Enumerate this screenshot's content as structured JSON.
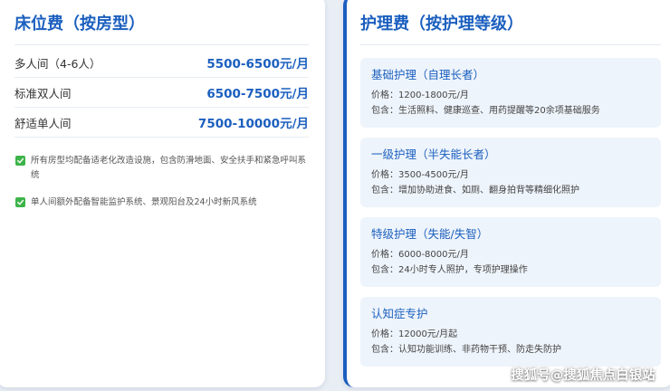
{
  "bed_fee": {
    "title": "床位费（按房型）",
    "rows": [
      {
        "label": "多人间（4-6人）",
        "price": "5500-6500元/月"
      },
      {
        "label": "标准双人间",
        "price": "6500-7500元/月"
      },
      {
        "label": "舒适单人间",
        "price": "7500-10000元/月"
      }
    ],
    "notes": [
      "所有房型均配备适老化改造设施，包含防滑地面、安全扶手和紧急呼叫系统",
      "单人间额外配备智能监护系统、景观阳台及24小时新风系统"
    ]
  },
  "care_fee": {
    "title": "护理费（按护理等级）",
    "items": [
      {
        "name": "基础护理（自理长者）",
        "price": "价格：1200-1800元/月",
        "includes": "包含：生活照料、健康巡查、用药提醒等20余项基础服务"
      },
      {
        "name": "一级护理（半失能长者）",
        "price": "价格：3500-4500元/月",
        "includes": "包含：增加协助进食、如厕、翻身拍背等精细化照护"
      },
      {
        "name": "特级护理（失能/失智）",
        "price": "价格：6000-8000元/月",
        "includes": "包含：24小时专人照护，专项护理操作"
      },
      {
        "name": "认知症专护",
        "price": "价格：12000元/月起",
        "includes": "包含：认知功能训练、非药物干预、防走失防护"
      }
    ]
  },
  "watermark": "搜狐号@搜狐焦点白银站",
  "colors": {
    "accent": "#1b5fbf",
    "check": "#3db449"
  },
  "icons": {
    "note_icon": "checkbox-checked-icon"
  }
}
